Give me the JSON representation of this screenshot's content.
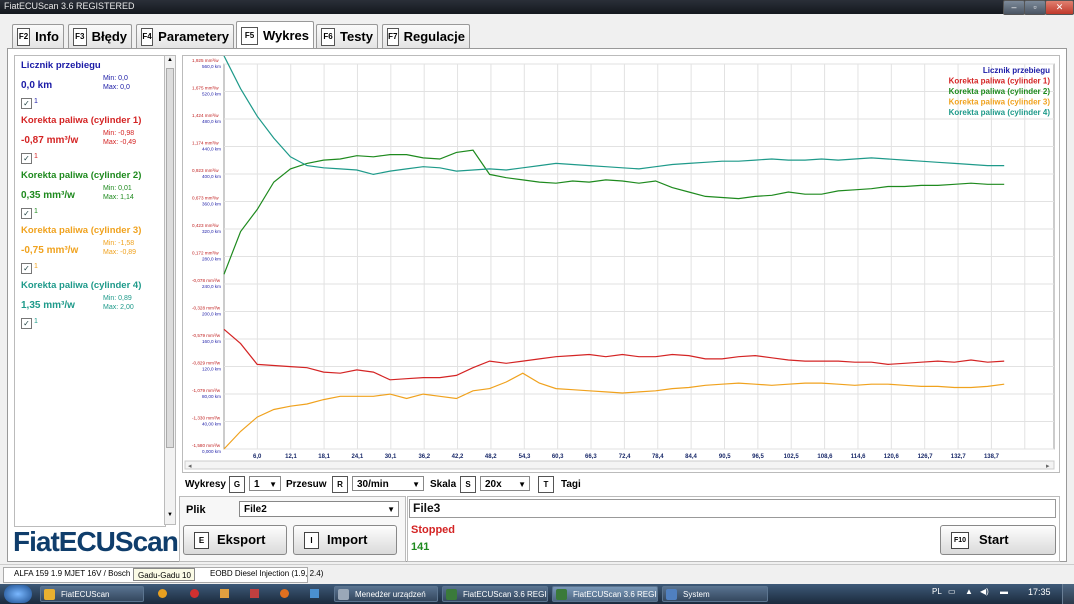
{
  "window": {
    "title": "FiatECUScan 3.6 REGISTERED"
  },
  "tabs": [
    {
      "key": "F2",
      "label": "Info"
    },
    {
      "key": "F3",
      "label": "Błędy"
    },
    {
      "key": "F4",
      "label": "Parametery"
    },
    {
      "key": "F5",
      "label": "Wykres"
    },
    {
      "key": "F6",
      "label": "Testy"
    },
    {
      "key": "F7",
      "label": "Regulacje"
    }
  ],
  "sensors": [
    {
      "name": "Licznik przebiegu",
      "value": "0,0 km",
      "min": "Min: 0,0",
      "max": "Max: 0,0",
      "checked": "1",
      "color": "#1a1aa6"
    },
    {
      "name": "Korekta paliwa (cylinder 1)",
      "value": "-0,87 mm³/w",
      "min": "Min: -0,98",
      "max": "Max: -0,49",
      "checked": "1",
      "color": "#d42424"
    },
    {
      "name": "Korekta paliwa (cylinder 2)",
      "value": "0,35 mm³/w",
      "min": "Min: 0,01",
      "max": "Max: 1,14",
      "checked": "1",
      "color": "#1e8a1e"
    },
    {
      "name": "Korekta paliwa (cylinder 3)",
      "value": "-0,75 mm³/w",
      "min": "Min: -1,58",
      "max": "Max: -0,89",
      "checked": "1",
      "color": "#f0a21e"
    },
    {
      "name": "Korekta paliwa (cylinder 4)",
      "value": "1,35 mm³/w",
      "min": "Min: 0,89",
      "max": "Max: 2,00",
      "checked": "1",
      "color": "#1e9a8a"
    }
  ],
  "chart_data": {
    "type": "line",
    "xlim": [
      0,
      150
    ],
    "x_ticks": [
      "6,0",
      "12,1",
      "18,1",
      "24,1",
      "30,1",
      "36,2",
      "42,2",
      "48,2",
      "54,3",
      "60,3",
      "66,3",
      "72,4",
      "78,4",
      "84,4",
      "90,5",
      "96,5",
      "102,5",
      "108,6",
      "114,6",
      "120,6",
      "126,7",
      "132,7",
      "138,7"
    ],
    "y_ticks_fuel": [
      "1,925 mm³/w",
      "1,675 mm³/w",
      "1,424 mm³/w",
      "1,174 mm³/w",
      "0,923 mm³/w",
      "0,673 mm³/w",
      "0,423 mm³/w",
      "0,172 mm³/w",
      "-0,078 mm³/w",
      "-0,328 mm³/w",
      "-0,579 mm³/w",
      "-0,829 mm³/w",
      "-1,079 mm³/w",
      "-1,330 mm³/w",
      "-1,580 mm³/w"
    ],
    "y_ticks_km": [
      "560,0 km",
      "520,0 km",
      "480,0 km",
      "440,0 km",
      "400,0 km",
      "360,0 km",
      "320,0 km",
      "280,0 km",
      "240,0 km",
      "200,0 km",
      "160,0 km",
      "120,0 km",
      "80,00 km",
      "40,00 km",
      "0,000 km"
    ],
    "ylim": [
      -1.58,
      1.925
    ],
    "legend": [
      {
        "name": "Licznik przebiegu",
        "color": "#1a1aa6"
      },
      {
        "name": "Korekta paliwa (cylinder 1)",
        "color": "#d42424"
      },
      {
        "name": "Korekta paliwa (cylinder 2)",
        "color": "#1e8a1e"
      },
      {
        "name": "Korekta paliwa (cylinder 3)",
        "color": "#f0a21e"
      },
      {
        "name": "Korekta paliwa (cylinder 4)",
        "color": "#1e9a8a"
      }
    ],
    "legend_position": "top-right",
    "grid": true,
    "x": [
      0,
      3,
      6,
      9,
      12,
      15,
      18,
      21,
      24,
      27,
      30,
      33,
      36,
      39,
      42,
      45,
      48,
      51,
      54,
      57,
      60,
      63,
      66,
      69,
      72,
      75,
      78,
      81,
      84,
      87,
      90,
      93,
      96,
      99,
      102,
      105,
      108,
      111,
      114,
      117,
      120,
      123,
      126,
      129,
      132,
      135,
      138,
      141
    ],
    "series": [
      {
        "name": "Korekta paliwa (cylinder 1)",
        "color": "#d42424",
        "values": [
          -0.49,
          -0.62,
          -0.81,
          -0.82,
          -0.83,
          -0.84,
          -0.88,
          -0.89,
          -0.86,
          -0.88,
          -0.95,
          -0.94,
          -0.93,
          -0.93,
          -0.91,
          -0.84,
          -0.78,
          -0.8,
          -0.78,
          -0.76,
          -0.74,
          -0.73,
          -0.72,
          -0.74,
          -0.72,
          -0.74,
          -0.74,
          -0.72,
          -0.73,
          -0.76,
          -0.76,
          -0.74,
          -0.73,
          -0.75,
          -0.77,
          -0.78,
          -0.78,
          -0.78,
          -0.79,
          -0.79,
          -0.81,
          -0.8,
          -0.79,
          -0.78,
          -0.79,
          -0.77,
          -0.79,
          -0.78
        ]
      },
      {
        "name": "Korekta paliwa (cylinder 2)",
        "color": "#1e8a1e",
        "values": [
          0.01,
          0.4,
          0.6,
          0.85,
          0.97,
          1.02,
          1.05,
          1.06,
          1.09,
          1.08,
          1.1,
          1.1,
          1.07,
          1.06,
          1.12,
          1.14,
          0.92,
          0.89,
          0.87,
          0.85,
          0.84,
          0.86,
          0.85,
          0.87,
          0.86,
          0.84,
          0.86,
          0.8,
          0.76,
          0.72,
          0.71,
          0.7,
          0.72,
          0.73,
          0.76,
          0.74,
          0.74,
          0.77,
          0.78,
          0.79,
          0.81,
          0.81,
          0.82,
          0.82,
          0.83,
          0.84,
          0.83,
          0.83
        ]
      },
      {
        "name": "Korekta paliwa (cylinder 3)",
        "color": "#f0a21e",
        "values": [
          -1.58,
          -1.42,
          -1.29,
          -1.22,
          -1.19,
          -1.17,
          -1.13,
          -1.1,
          -1.1,
          -1.1,
          -1.08,
          -1.12,
          -1.08,
          -1.1,
          -1.12,
          -1.05,
          -1.03,
          -0.97,
          -0.89,
          -0.98,
          -1.03,
          -1.04,
          -1.05,
          -1.06,
          -1.07,
          -1.06,
          -1.05,
          -1.03,
          -1.02,
          -1.0,
          -0.99,
          -0.98,
          -0.99,
          -1.0,
          -0.99,
          -0.98,
          -0.98,
          -0.99,
          -1.0,
          -0.99,
          -0.99,
          -1.0,
          -1.01,
          -1.01,
          -1.02,
          -1.02,
          -1.01,
          -0.99
        ]
      },
      {
        "name": "Korekta paliwa (cylinder 4)",
        "color": "#1e9a8a",
        "values": [
          2.0,
          1.7,
          1.45,
          1.25,
          1.08,
          1.0,
          0.98,
          0.97,
          0.96,
          0.92,
          0.95,
          0.97,
          0.99,
          0.98,
          0.95,
          0.96,
          0.97,
          0.96,
          0.98,
          1.0,
          1.02,
          1.01,
          1.0,
          0.99,
          0.98,
          0.97,
          0.99,
          1.01,
          1.02,
          1.03,
          1.04,
          1.04,
          1.05,
          1.06,
          1.05,
          1.05,
          1.06,
          1.05,
          1.06,
          1.07,
          1.06,
          1.05,
          1.04,
          1.03,
          1.02,
          1.01,
          1.0,
          1.0
        ]
      }
    ]
  },
  "controls": {
    "wykresy_label": "Wykresy",
    "wykresy_key": "G",
    "wykresy_value": "1",
    "przesuw_label": "Przesuw",
    "przesuw_key": "R",
    "przesuw_value": "30/min",
    "skala_label": "Skala",
    "skala_key": "S",
    "skala_value": "20x",
    "tagi_label": "Tagi",
    "tagi_key": "T"
  },
  "file": {
    "plik_label": "Plik",
    "plik_value": "File2",
    "eksport_key": "E",
    "eksport_label": "Eksport",
    "import_key": "I",
    "import_label": "Import",
    "current_file": "File3",
    "status": "Stopped",
    "count": "141",
    "start_key": "F10",
    "start_label": "Start"
  },
  "branding": {
    "logo": "FiatECUScan"
  },
  "statusbar": {
    "vehicle": "ALFA 159 1.9 MJET 16V / Bosch",
    "tooltip": "Gadu-Gadu 10",
    "ecu": "EOBD Diesel Injection (1.9, 2.4)"
  },
  "taskbar": {
    "items": [
      "FiatECUScan",
      "Menedżer urządzeń",
      "FiatECUScan 3.6 REGI...",
      "FiatECUScan 3.6 REGI...",
      "System"
    ],
    "lang": "PL",
    "time": "17:35"
  }
}
